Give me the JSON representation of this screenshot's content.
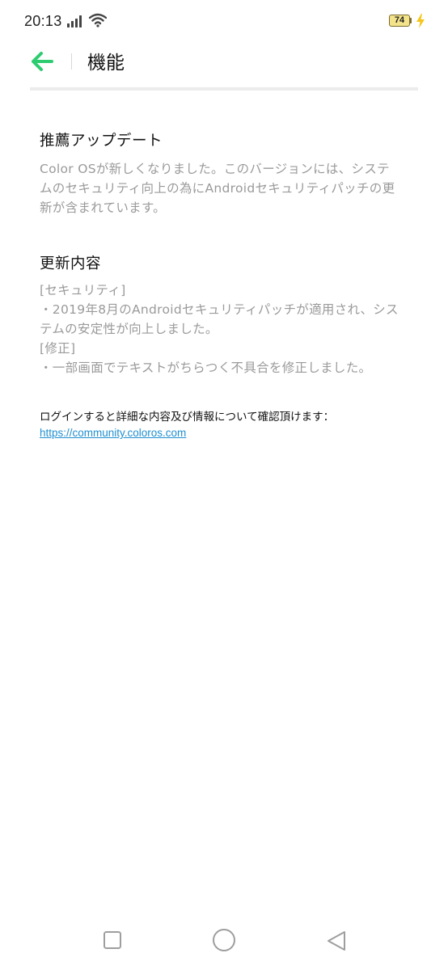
{
  "status_bar": {
    "time": "20:13",
    "battery_level": "74",
    "icons": [
      "signal-icon",
      "wifi-icon",
      "battery-icon",
      "charging-icon"
    ]
  },
  "header": {
    "title": "機能",
    "back_icon": "arrow-left-icon",
    "accent_color": "#2ecc71"
  },
  "sections": {
    "recommended": {
      "heading": "推薦アップデート",
      "lines": [
        "Color OSが新しくなりました。このバージョンには、システ",
        "ムのセキュリティ向上の為にAndroidセキュリティパッチの更",
        "新が含まれています。"
      ]
    },
    "changes": {
      "heading": "更新内容",
      "lines": [
        "[セキュリティ]",
        "・2019年8月のAndroidセキュリティパッチが適用され、シス",
        "テムの安定性が向上しました。",
        "[修正]",
        "・一部画面でテキストがちらつく不具合を修正しました。"
      ]
    }
  },
  "footer": {
    "note": "ログインすると詳細な内容及び情報について確認頂けます：",
    "link": "https://community.coloros.com",
    "link_color": "#1f8fd0"
  },
  "nav_bar": {
    "icons": [
      "recents-square-icon",
      "home-circle-icon",
      "back-triangle-icon"
    ]
  }
}
